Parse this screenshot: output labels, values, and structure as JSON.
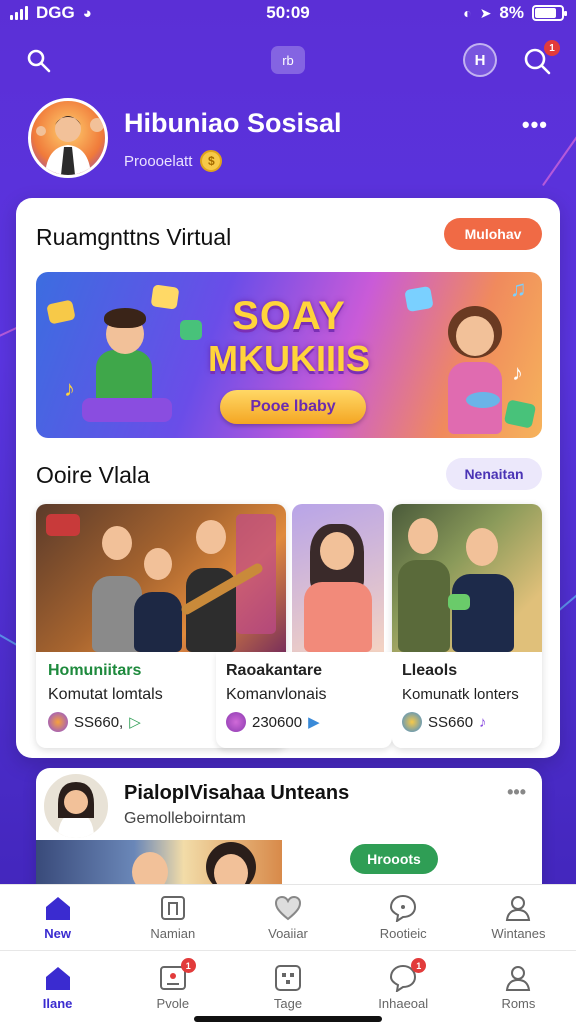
{
  "status_bar": {
    "carrier": "DGG",
    "time": "50:09",
    "battery_percent": "8%",
    "battery_level": 0.8
  },
  "top_bar": {
    "left_icon": "search-icon",
    "center_icon": "app-chip-icon",
    "center_chip_label": "rb",
    "profile_button_label": "H",
    "right_icon": "search-icon",
    "notification_count": "1"
  },
  "profile": {
    "name": "Hibuniao Sosisal",
    "subtitle": "Proooelatt",
    "coin_glyph": "$"
  },
  "featured": {
    "title": "Ruamgnttns Virtual",
    "action_label": "Mulohav",
    "banner": {
      "headline_1": "SOAY",
      "headline_2": "MKUKIIIS",
      "cta_label": "Pooe lbaby"
    }
  },
  "communities": {
    "title": "Ooire Vlala",
    "action_label": "Nenaitan",
    "items": [
      {
        "title": "Homuniitars",
        "subtitle": "Komutat lomtals",
        "count": "SS660,",
        "title_color": "#1e8a3d"
      },
      {
        "title": "Raoakantare",
        "subtitle": "Komanvlonais",
        "count": "230600",
        "title_color": "#111111"
      },
      {
        "title": "Lleaols",
        "subtitle": "Komunatk lonters",
        "count": "SS660",
        "title_color": "#111111"
      }
    ]
  },
  "post_card": {
    "title": "PialopIVisahaa Unteans",
    "subtitle": "Gemolleboirntam",
    "action_label": "Hrooots"
  },
  "nav_primary": {
    "items": [
      {
        "label": "New",
        "icon": "home-icon",
        "active": true
      },
      {
        "label": "Namian",
        "icon": "bookmark-icon",
        "active": false
      },
      {
        "label": "Voaiiar",
        "icon": "heart-icon",
        "active": false
      },
      {
        "label": "Rootieic",
        "icon": "chat-icon",
        "active": false
      },
      {
        "label": "Wintanes",
        "icon": "user-icon",
        "active": false
      }
    ]
  },
  "nav_secondary": {
    "items": [
      {
        "label": "Ilane",
        "icon": "home-icon",
        "active": true,
        "badge": ""
      },
      {
        "label": "Pvole",
        "icon": "profile-card-icon",
        "active": false,
        "badge": "1"
      },
      {
        "label": "Tage",
        "icon": "grid-icon",
        "active": false,
        "badge": ""
      },
      {
        "label": "Inhaeoal",
        "icon": "chat-icon",
        "active": false,
        "badge": "1"
      },
      {
        "label": "Roms",
        "icon": "user-icon",
        "active": false,
        "badge": ""
      }
    ]
  },
  "colors": {
    "brand_purple": "#5a35e0",
    "accent_orange": "#f06a45",
    "pill_lavender": "#ece8fb",
    "follow_green": "#2f9e55",
    "active_nav": "#3a2bd0"
  }
}
